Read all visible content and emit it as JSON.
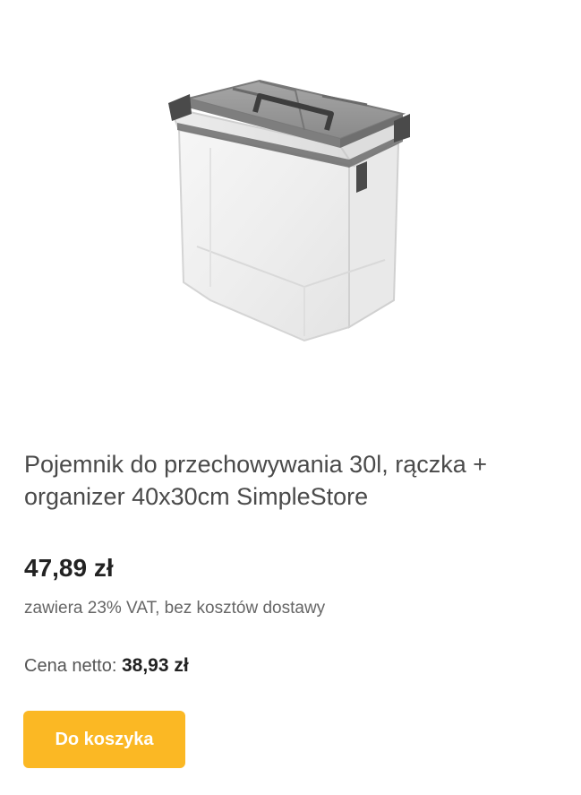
{
  "product": {
    "image_alt": "Pojemnik do przechowywania 30l, rączka + organizer 40x30cm SimpleStore",
    "title": "Pojemnik do przechowywania 30l, rączka + organizer 40x30cm SimpleStore",
    "price": "47,89 zł",
    "vat_note": "zawiera 23% VAT, bez kosztów dostawy",
    "net_label": "Cena netto:",
    "net_value": "38,93 zł",
    "add_to_cart_label": "Do koszyka"
  },
  "colors": {
    "accent": "#fbb824",
    "text_primary": "#222222",
    "text_secondary": "#666666"
  }
}
